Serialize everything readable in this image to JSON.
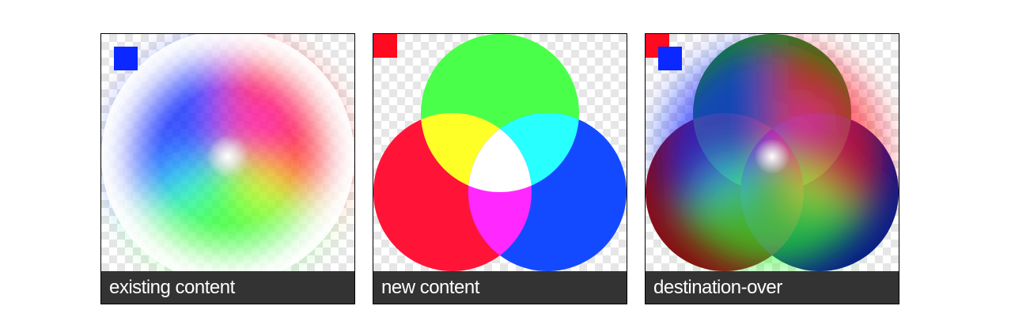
{
  "panels": [
    {
      "caption": "existing content",
      "art": "color-wheel",
      "marker_colors": [
        "#0a28ff"
      ]
    },
    {
      "caption": "new content",
      "art": "rgb-circles",
      "marker_colors": [
        "#ff0a1e"
      ]
    },
    {
      "caption": "destination-over",
      "art": "wheel-over-circles",
      "marker_colors": [
        "#ff0a1e",
        "#0a28ff"
      ]
    }
  ],
  "colors": {
    "red": "#ff0a1e",
    "green": "#28ff28",
    "blue": "#0a28ff",
    "caption_background": "#333333",
    "caption_text": "#ffffff"
  }
}
